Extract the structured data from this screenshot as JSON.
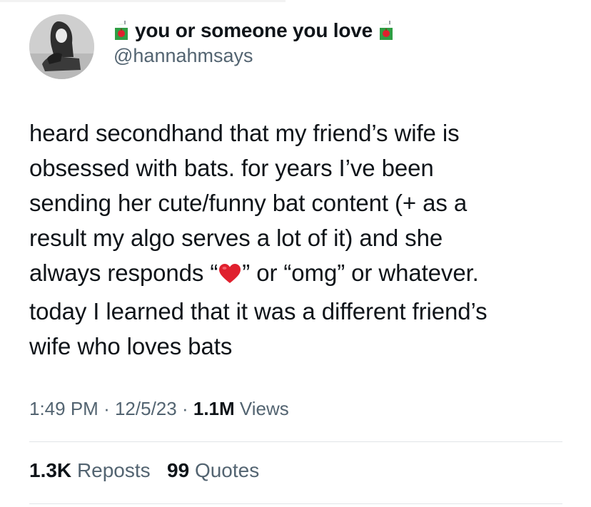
{
  "user": {
    "display_name": "you or someone you love",
    "handle": "@hannahmsays",
    "name_emoji": "juice-box-icon"
  },
  "tweet": {
    "lines": [
      "heard secondhand that my friend’s wife is",
      "obsessed with bats. for years I’ve been",
      "sending her cute/funny bat content (+ as a",
      "result my algo serves a lot of it) and she",
      "today I learned that it was a different friend’s",
      "wife who loves bats"
    ],
    "line5_before": "always responds “",
    "line5_after": "” or “omg” or whatever.",
    "inline_emoji": "red-heart-icon"
  },
  "meta": {
    "time": "1:49 PM",
    "sep1": "·",
    "date": "12/5/23",
    "sep2": "·",
    "views_count": "1.1M",
    "views_label": "Views"
  },
  "stats": {
    "reposts_count": "1.3K",
    "reposts_label": "Reposts",
    "quotes_count": "99",
    "quotes_label": "Quotes"
  },
  "colors": {
    "text": "#0f1419",
    "secondary": "#536471",
    "divider": "#e1e4e8",
    "heart": "#e0202e",
    "juice_box": "#2f9e44"
  }
}
